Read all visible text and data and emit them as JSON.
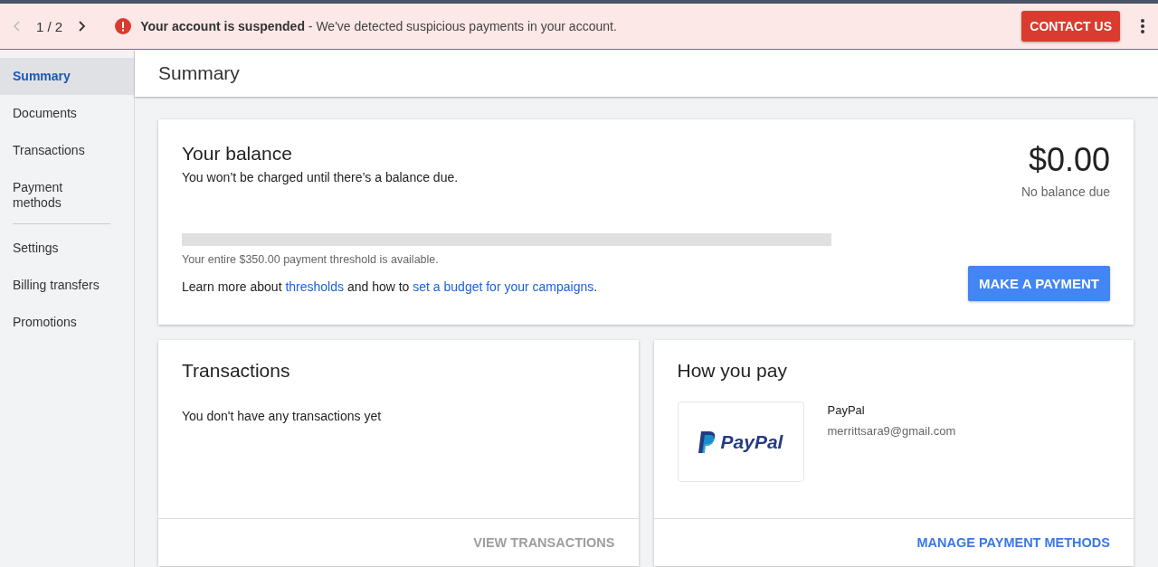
{
  "banner": {
    "pager": "1 / 2",
    "message": "**Your account is suspended** - We've detected suspicious payments in your account.",
    "button": "CONTACT US"
  },
  "sidebar": {
    "items": [
      {
        "label": "Summary",
        "selected": true,
        "divider_after": false
      },
      {
        "label": "Documents",
        "selected": false,
        "divider_after": false
      },
      {
        "label": "Transactions",
        "selected": false,
        "divider_after": false
      },
      {
        "label": "Payment methods",
        "selected": false,
        "divider_after": true
      },
      {
        "label": "Settings",
        "selected": false,
        "divider_after": false
      },
      {
        "label": "Billing transfers",
        "selected": false,
        "divider_after": false
      },
      {
        "label": "Promotions",
        "selected": false,
        "divider_after": false
      }
    ]
  },
  "page_title": "Summary",
  "balance": {
    "title": "Your balance",
    "subtitle": "You won’t be charged until there’s a balance due.",
    "amount": "$0.00",
    "amount_note": "No balance due",
    "threshold": {
      "level": 0,
      "note": "Your entire $350.00 payment threshold is available."
    },
    "learn_more": [
      {
        "kind": "text",
        "text": "Learn more about "
      },
      {
        "kind": "link",
        "text": "thresholds"
      },
      {
        "kind": "text",
        "text": " and how to "
      },
      {
        "kind": "link",
        "text": "set a budget for your campaigns"
      },
      {
        "kind": "text",
        "text": "."
      }
    ],
    "button": "MAKE A PAYMENT"
  },
  "transactions": {
    "title": "Transactions",
    "empty": "You don't have any transactions yet",
    "action": {
      "label": "VIEW TRANSACTIONS",
      "disabled": true
    }
  },
  "how_you_pay": {
    "title": "How you pay",
    "logo_text": "PayPal",
    "method": "PayPal",
    "account": "merrittsara9@gmail.com",
    "action": {
      "label": "MANAGE PAYMENT METHODS",
      "disabled": false
    }
  }
}
